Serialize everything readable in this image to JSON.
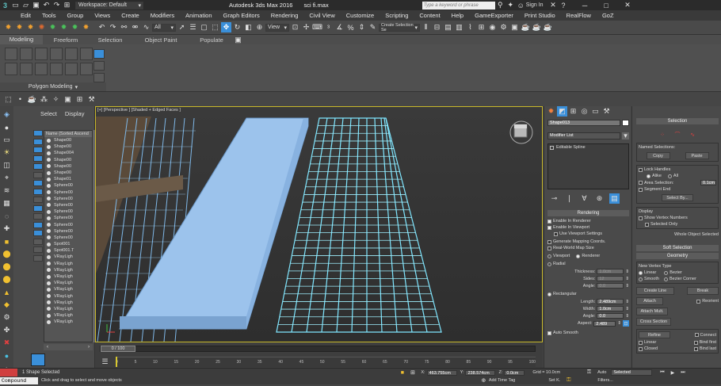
{
  "title": {
    "workspace_label": "Workspace: Default",
    "app_title": "Autodesk 3ds Max 2016",
    "file_name": "sci fi.max",
    "search_placeholder": "Type a keyword or phrase",
    "sign_in": "Sign In"
  },
  "menu": [
    "Edit",
    "Tools",
    "Group",
    "Views",
    "Create",
    "Modifiers",
    "Animation",
    "Graph Editors",
    "Rendering",
    "Civil View",
    "Customize",
    "Scripting",
    "Content",
    "Help",
    "GameExporter",
    "Print Studio",
    "RealFlow",
    "GoZ"
  ],
  "toolbar": {
    "filter_select": "All",
    "view_select": "View",
    "selection_set_placeholder": "Create Selection Se"
  },
  "ribbon": {
    "tabs": [
      "Modeling",
      "Freeform",
      "Selection",
      "Object Paint",
      "Populate"
    ],
    "panel_label": "Polygon Modeling"
  },
  "scene_explorer": {
    "tabs": [
      "Select",
      "Display"
    ],
    "header": "Name (Sorted Ascend",
    "items": [
      "Shape00",
      "Shape00",
      "Shape004",
      "Shape00",
      "Shape00",
      "Shape00",
      "Shape01",
      "Sphere00",
      "Sphere00",
      "Sphere00",
      "Sphere00",
      "Sphere00",
      "Sphere00",
      "Sphere00",
      "Sphere00",
      "Sphere00",
      "Spot001",
      "Spot001.T",
      "VRayLigh",
      "VRayLigh",
      "VRayLigh",
      "VRayLigh",
      "VRayLigh",
      "VRayLigh",
      "VRayLigh",
      "VRayLigh",
      "VRayLigh",
      "VRayLigh",
      "VRayLigh"
    ]
  },
  "viewport": {
    "label": "[+] [Perspective ] [Shaded + Edged Faces ]"
  },
  "timeline": {
    "frame_counter": "0 / 100",
    "ticks": [
      "0",
      "5",
      "10",
      "15",
      "20",
      "25",
      "30",
      "35",
      "40",
      "45",
      "50",
      "55",
      "60",
      "65",
      "70",
      "75",
      "80",
      "85",
      "90",
      "95",
      "100"
    ]
  },
  "modify_panel": {
    "object_name": "Shape013",
    "modifier_list": "Modifier List",
    "stack_item": "Editable Spline",
    "rendering": {
      "title": "Rendering",
      "enable_renderer": "Enable In Renderer",
      "enable_viewport": "Enable In Viewport",
      "use_viewport": "Use Viewport Settings",
      "gen_mapping": "Generate Mapping Coords.",
      "real_world": "Real-World Map Size",
      "viewport_radio": "Viewport",
      "renderer_radio": "Renderer",
      "radial": "Radial",
      "thickness_label": "Thickness:",
      "thickness_val": "1.0cm",
      "sides_label": "Sides:",
      "sides_val": "12",
      "angle_label": "Angle:",
      "angle_val": "0.0",
      "rectangular": "Rectangular",
      "length_label": "Length:",
      "length_val": "2.489cm",
      "width_label": "Width:",
      "width_val": "1.0cm",
      "angle2_label": "Angle:",
      "angle2_val": "0.0",
      "aspect_label": "Aspect:",
      "aspect_val": "2.489",
      "auto_smooth": "Auto Smooth"
    }
  },
  "right_panel": {
    "selection_title": "Selection",
    "named_selections": "Named Selections:",
    "copy": "Copy",
    "paste": "Paste",
    "lock_handles": "Lock Handles",
    "alike": "Alike",
    "all": "All",
    "area_selection": "Area Selection:",
    "area_val": "0.1cm",
    "segment_end": "Segment End",
    "select_by": "Select By...",
    "display": "Display",
    "show_vertex": "Show Vertex Numbers",
    "selected_only": "Selected Only",
    "whole_object": "Whole Object Selected",
    "soft_selection": "Soft Selection",
    "geometry": "Geometry",
    "new_vertex_type": "New Vertex Type",
    "linear": "Linear",
    "bezier": "Bezier",
    "smooth": "Smooth",
    "bezier_corner": "Bezier Corner",
    "create_line": "Create Line",
    "break": "Break",
    "attach": "Attach",
    "reorient": "Reorient",
    "attach_mult": "Attach Mult.",
    "cross_section": "Cross Section",
    "refine": "Refine",
    "connect": "Connect",
    "linear2": "Linear",
    "bind_first": "Bind first",
    "closed": "Closed",
    "bind_last": "Bind last"
  },
  "status": {
    "selection_info": "1 Shape Selected",
    "prompt": "Click and drag to select and move objects",
    "compound": "Compound",
    "x_label": "X:",
    "x_val": "463.755cm",
    "y_label": "Y:",
    "y_val": "238.574cm",
    "z_label": "Z:",
    "z_val": "0.0cm",
    "grid": "Grid = 10.0cm",
    "add_time_tag": "Add Time Tag",
    "auto": "Auto",
    "selected": "Selected",
    "set_k": "Set K.",
    "filters": "Filters..."
  },
  "colors": {
    "accent_blue": "#3a8fd9",
    "viewport_border": "#c8b82a",
    "spline_cyan": "#7fe6ff",
    "slab_blue": "#9cc3ec"
  }
}
